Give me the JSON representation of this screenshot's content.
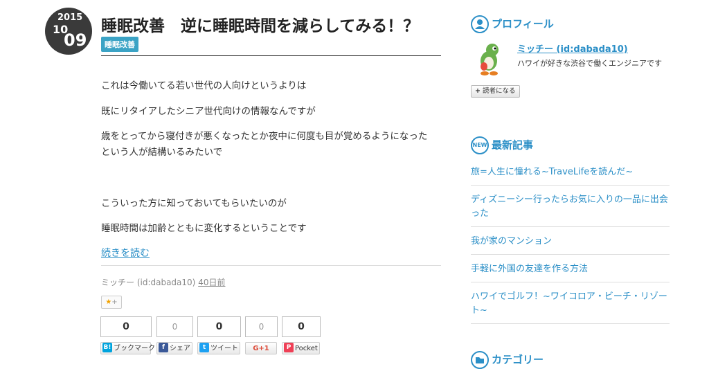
{
  "post": {
    "date": {
      "year": "2015",
      "month": "10",
      "day": "09"
    },
    "title": "睡眠改善　逆に睡眠時間を減らしてみる！？",
    "category": "睡眠改善",
    "body_lines": [
      "これは今働いてる若い世代の人向けというよりは",
      "既にリタイアしたシニア世代向けの情報なんですが",
      "歳をとってから寝付きが悪くなったとか夜中に何度も目が覚めるようになった",
      "という人が結構いるみたいで",
      "こういった方に知っておいてもらいたいのが",
      "睡眠時間は加齢とともに変化するということです"
    ],
    "read_more": "続きを読む",
    "author": "ミッチー (id:dabada10)",
    "time_ago": "40日前",
    "star_label": "★",
    "star_plus": "+"
  },
  "share": {
    "counts": [
      "0",
      "0",
      "0",
      "0",
      "0"
    ],
    "buttons": [
      {
        "icon": "B!",
        "label": "ブックマーク",
        "color": "#00a4de"
      },
      {
        "icon": "f",
        "label": "シェア",
        "color": "#3b5998"
      },
      {
        "icon": "t",
        "label": "ツイート",
        "color": "#1da1f2"
      },
      {
        "icon": "G+1",
        "label": "",
        "color": "#dd4b39"
      },
      {
        "icon": "P",
        "label": "Pocket",
        "color": "#ef4056"
      }
    ]
  },
  "sidebar": {
    "profile": {
      "heading": "プロフィール",
      "name": "ミッチー (id:dabada10)",
      "description": "ハワイが好きな渋谷で働くエンジニアです",
      "subscribe": "読者になる",
      "subscribe_plus": "+"
    },
    "recent": {
      "heading": "最新記事",
      "badge": "NEW",
      "items": [
        "旅=人生に憧れる~TraveLifeを読んだ~",
        "ディズニーシー行ったらお気に入りの一品に出会った",
        "我が家のマンション",
        "手軽に外国の友達を作る方法",
        "ハワイでゴルフ！~ワイコロア・ビーチ・リゾート~"
      ]
    },
    "category": {
      "heading": "カテゴリー"
    }
  },
  "colors": {
    "accent": "#2b8fc7",
    "category_badge": "#3ba3c5",
    "date_circle": "#3a3a3a"
  }
}
